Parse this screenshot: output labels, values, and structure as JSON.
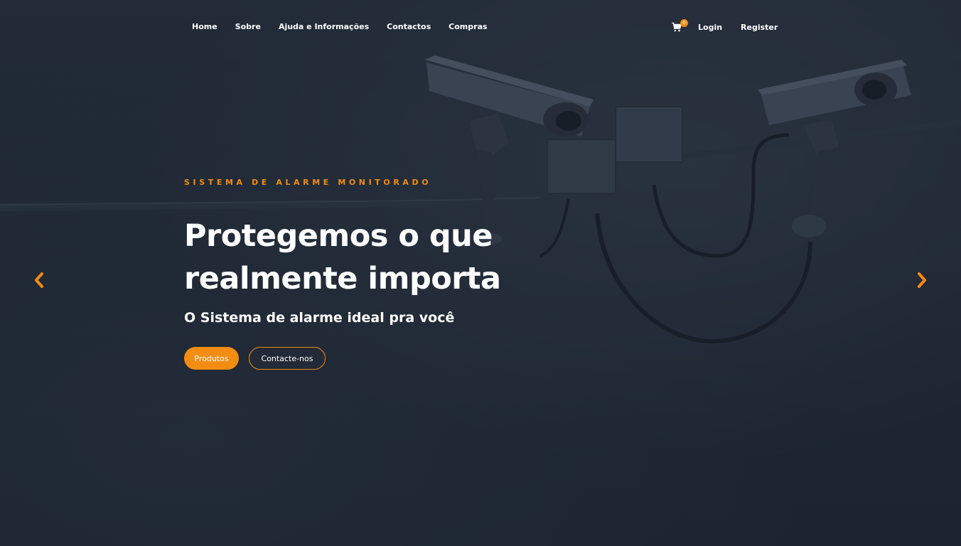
{
  "nav": {
    "links": [
      "Home",
      "Sobre",
      "Ajuda e Informações",
      "Contactos",
      "Compras"
    ],
    "cart_count": "0",
    "login": "Login",
    "register": "Register"
  },
  "hero": {
    "eyebrow": "SISTEMA DE ALARME MONITORADO",
    "headline": "Protegemos o que realmente importa",
    "subhead": "O Sistema de alarme ideal pra você",
    "primary_button": "Produtos",
    "secondary_button": "Contacte-nos",
    "background_image": "surveillance-cameras-on-wall"
  },
  "carousel": {
    "prev_icon": "chevron-left-icon",
    "next_icon": "chevron-right-icon"
  },
  "colors": {
    "accent": "#f28c13",
    "background": "#1f2733",
    "text": "#ffffff"
  }
}
